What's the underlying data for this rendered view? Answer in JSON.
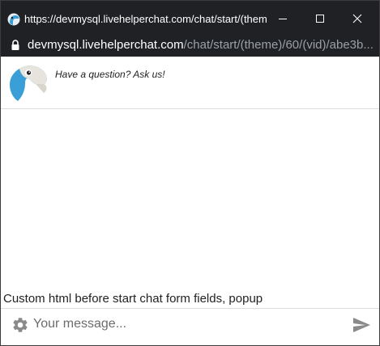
{
  "window": {
    "title": "https://devmysql.livehelperchat.com/chat/start/(theme..."
  },
  "address": {
    "host": "devmysql.livehelperchat.com",
    "path": "/chat/start/(theme)/60/(vid)/abe3b..."
  },
  "header": {
    "tagline": "Have a question? Ask us!"
  },
  "body": {
    "custom_html": "Custom html before start chat form fields, popup"
  },
  "composer": {
    "placeholder": "Your message..."
  },
  "icons": {
    "favicon": "parrot-favicon",
    "minimize": "minimize-icon",
    "maximize": "maximize-icon",
    "close": "close-icon",
    "lock": "lock-icon",
    "logo": "parrot-logo",
    "settings": "gear-icon",
    "send": "send-icon"
  },
  "colors": {
    "titlebar_bg": "#202124",
    "url_path": "#9aa0a6",
    "parrot_blue": "#3a9fd6",
    "icon_grey": "#8a8a8a"
  }
}
